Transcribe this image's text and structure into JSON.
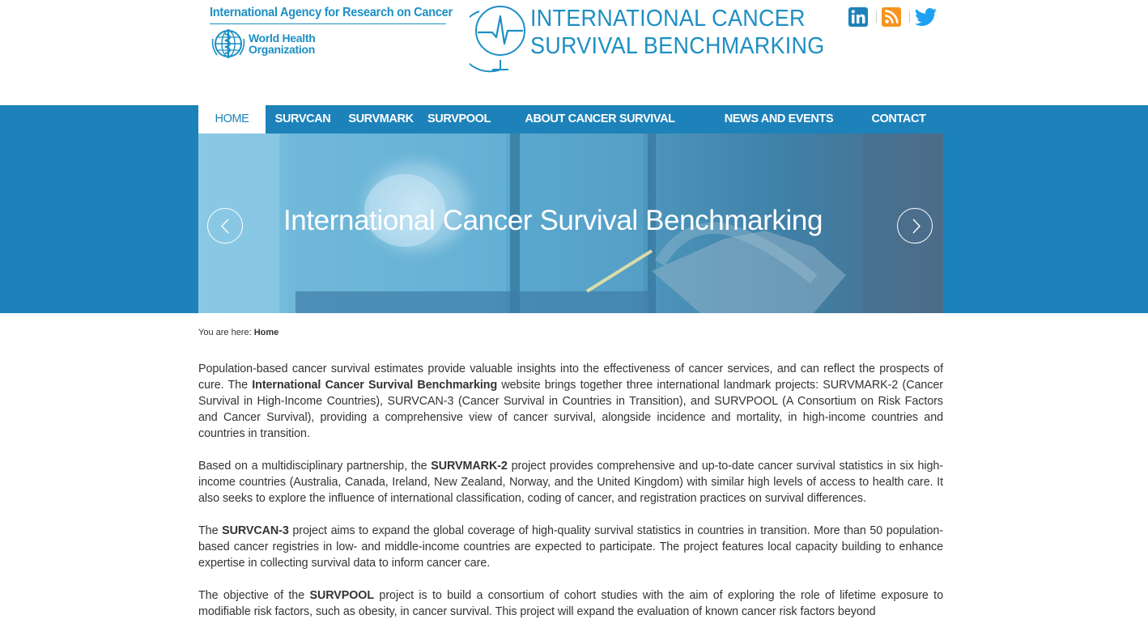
{
  "header": {
    "iarc_name": "International Agency for Research on Cancer",
    "who_line1": "World Health",
    "who_line2": "Organization",
    "site_title_line1": "INTERNATIONAL CANCER",
    "site_title_line2": "SURVIVAL BENCHMARKING",
    "social": [
      {
        "name": "linkedin",
        "label": "in",
        "color": "#1d82ba"
      },
      {
        "name": "rss",
        "color": "#f7941e"
      },
      {
        "name": "twitter",
        "color": "#1da1f2"
      }
    ]
  },
  "nav": {
    "items": [
      {
        "label": "HOME",
        "active": true
      },
      {
        "label": "SURVCAN"
      },
      {
        "label": "SURVMARK"
      },
      {
        "label": "SURVPOOL"
      },
      {
        "label": "ABOUT CANCER SURVIVAL"
      },
      {
        "label": "NEWS AND EVENTS"
      },
      {
        "label": "CONTACT"
      }
    ]
  },
  "hero": {
    "title": "International Cancer Survival Benchmarking"
  },
  "breadcrumb": {
    "prefix": "You are here:",
    "current": "Home"
  },
  "content": {
    "p1": [
      "Population-based cancer survival estimates provide valuable insights into the effectiveness of cancer services, and can reflect the prospects of cure. The ",
      "International Cancer Survival Benchmarking",
      " website brings together three international landmark projects: SURVMARK-2 (Cancer Survival in High-Income Countries), SURVCAN-3 (Cancer Survival in Countries in Transition), and SURVPOOL (A Consortium on Risk Factors and Cancer Survival), providing a comprehensive view of cancer survival, alongside incidence and mortality, in high-income countries and countries in transition."
    ],
    "p2": [
      "Based on a multidisciplinary partnership, the ",
      "SURVMARK-2",
      " project provides comprehensive and up-to-date cancer survival statistics in six high-income countries (Australia, Canada, Ireland, New Zealand, Norway, and the United Kingdom) with similar high levels of access to health care. It also seeks to explore the influence of international classification, coding of cancer, and registration practices on survival differences."
    ],
    "p3": [
      "The ",
      "SURVCAN-3",
      " project aims to expand the global coverage of high-quality survival statistics in countries in transition. More than 50 population-based cancer registries in low- and middle-income countries are expected to participate. The project features local capacity building to enhance expertise in collecting survival data to inform cancer care."
    ],
    "p4": [
      "The objective of the ",
      "SURVPOOL",
      " project is to build a consortium of cohort studies with the aim of exploring the role of lifetime exposure to modifiable risk factors, such as obesity, in cancer survival. This project will expand the evaluation of known cancer risk factors beyond"
    ]
  },
  "colors": {
    "brand_blue": "#1d82ba",
    "logo_blue": "#1d8fc4",
    "text": "#333333"
  }
}
